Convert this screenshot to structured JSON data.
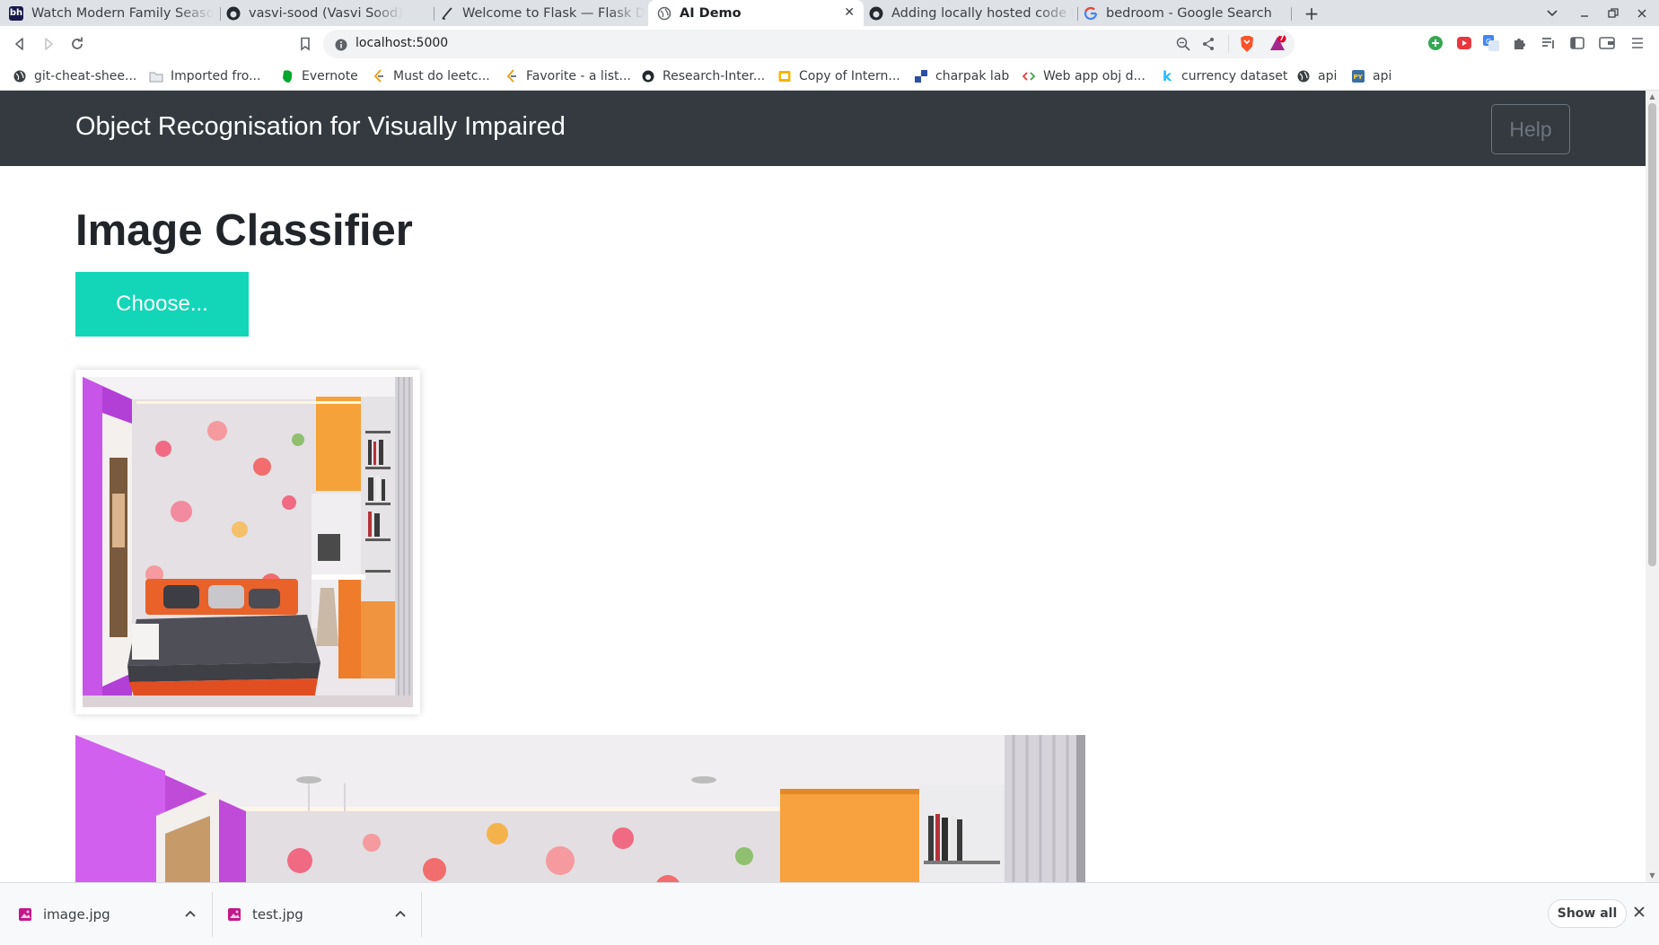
{
  "browser": {
    "tabs": [
      {
        "title": "Watch Modern Family Season",
        "icon": "hulu-like-favicon"
      },
      {
        "title": "vasvi-sood (Vasvi Sood)",
        "icon": "github-icon"
      },
      {
        "title": "Welcome to Flask — Flask Do",
        "icon": "flask-icon"
      },
      {
        "title": "AI Demo",
        "icon": "globe-icon",
        "active": true
      },
      {
        "title": "Adding locally hosted code to",
        "icon": "github-icon"
      },
      {
        "title": "bedroom - Google Search",
        "icon": "google-icon"
      }
    ],
    "new_tab_symbol": "+",
    "url": "localhost:5000",
    "brave_badge": "7",
    "bookmarks": [
      {
        "label": "git-cheat-shee...",
        "icon": "globe-icon"
      },
      {
        "label": "Imported fro...",
        "icon": "folder-icon"
      },
      {
        "label": "Evernote",
        "icon": "evernote-icon"
      },
      {
        "label": "Must do leetc...",
        "icon": "leetcode-icon"
      },
      {
        "label": "Favorite - a list...",
        "icon": "leetcode-icon"
      },
      {
        "label": "Research-Inter...",
        "icon": "github-icon"
      },
      {
        "label": "Copy of Intern...",
        "icon": "slides-icon"
      },
      {
        "label": "charpak lab",
        "icon": "checker-icon"
      },
      {
        "label": "Web app obj d...",
        "icon": "code-icon"
      },
      {
        "label": "currency dataset",
        "icon": "kaggle-icon"
      },
      {
        "label": "api",
        "icon": "globe-icon"
      },
      {
        "label": "api",
        "icon": "python-icon"
      }
    ]
  },
  "app": {
    "brand": "Object Recognisation for Visually Impaired",
    "help_label": "Help",
    "page_title": "Image Classifier",
    "choose_label": "Choose..."
  },
  "downloads": {
    "items": [
      {
        "name": "image.jpg"
      },
      {
        "name": "test.jpg"
      }
    ],
    "show_all_label": "Show all"
  },
  "colors": {
    "navbar": "#343a40",
    "accent_button": "#13d6b8",
    "help_outline": "#6c757d"
  }
}
